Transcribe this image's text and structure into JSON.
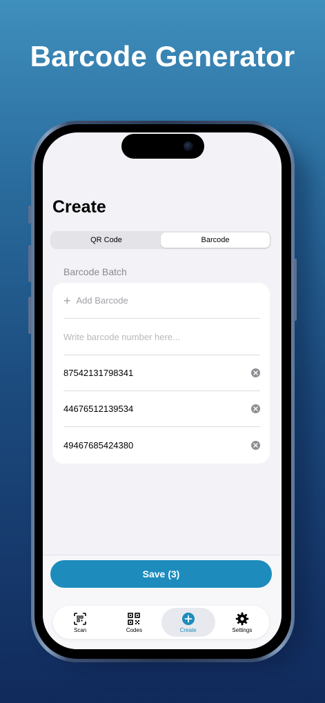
{
  "headline": "Barcode Generator",
  "screen": {
    "title": "Create",
    "segments": [
      {
        "label": "QR Code",
        "selected": false
      },
      {
        "label": "Barcode",
        "selected": true
      }
    ],
    "section_label": "Barcode Batch",
    "add_label": "Add Barcode",
    "input": {
      "value": "",
      "placeholder": "Write barcode number here..."
    },
    "codes": [
      "87542131798341",
      "44676512139534",
      "49467685424380"
    ],
    "save_label": "Save (3)",
    "tabs": [
      {
        "label": "Scan",
        "icon": "scan-icon"
      },
      {
        "label": "Codes",
        "icon": "qr-code-icon"
      },
      {
        "label": "Create",
        "icon": "plus-circle-icon",
        "active": true
      },
      {
        "label": "Settings",
        "icon": "gear-icon"
      }
    ]
  },
  "colors": {
    "accent": "#1d8cbd",
    "background_top": "#3f8fbd",
    "background_bottom": "#112a5c",
    "screen_bg": "#f2f2f7"
  }
}
